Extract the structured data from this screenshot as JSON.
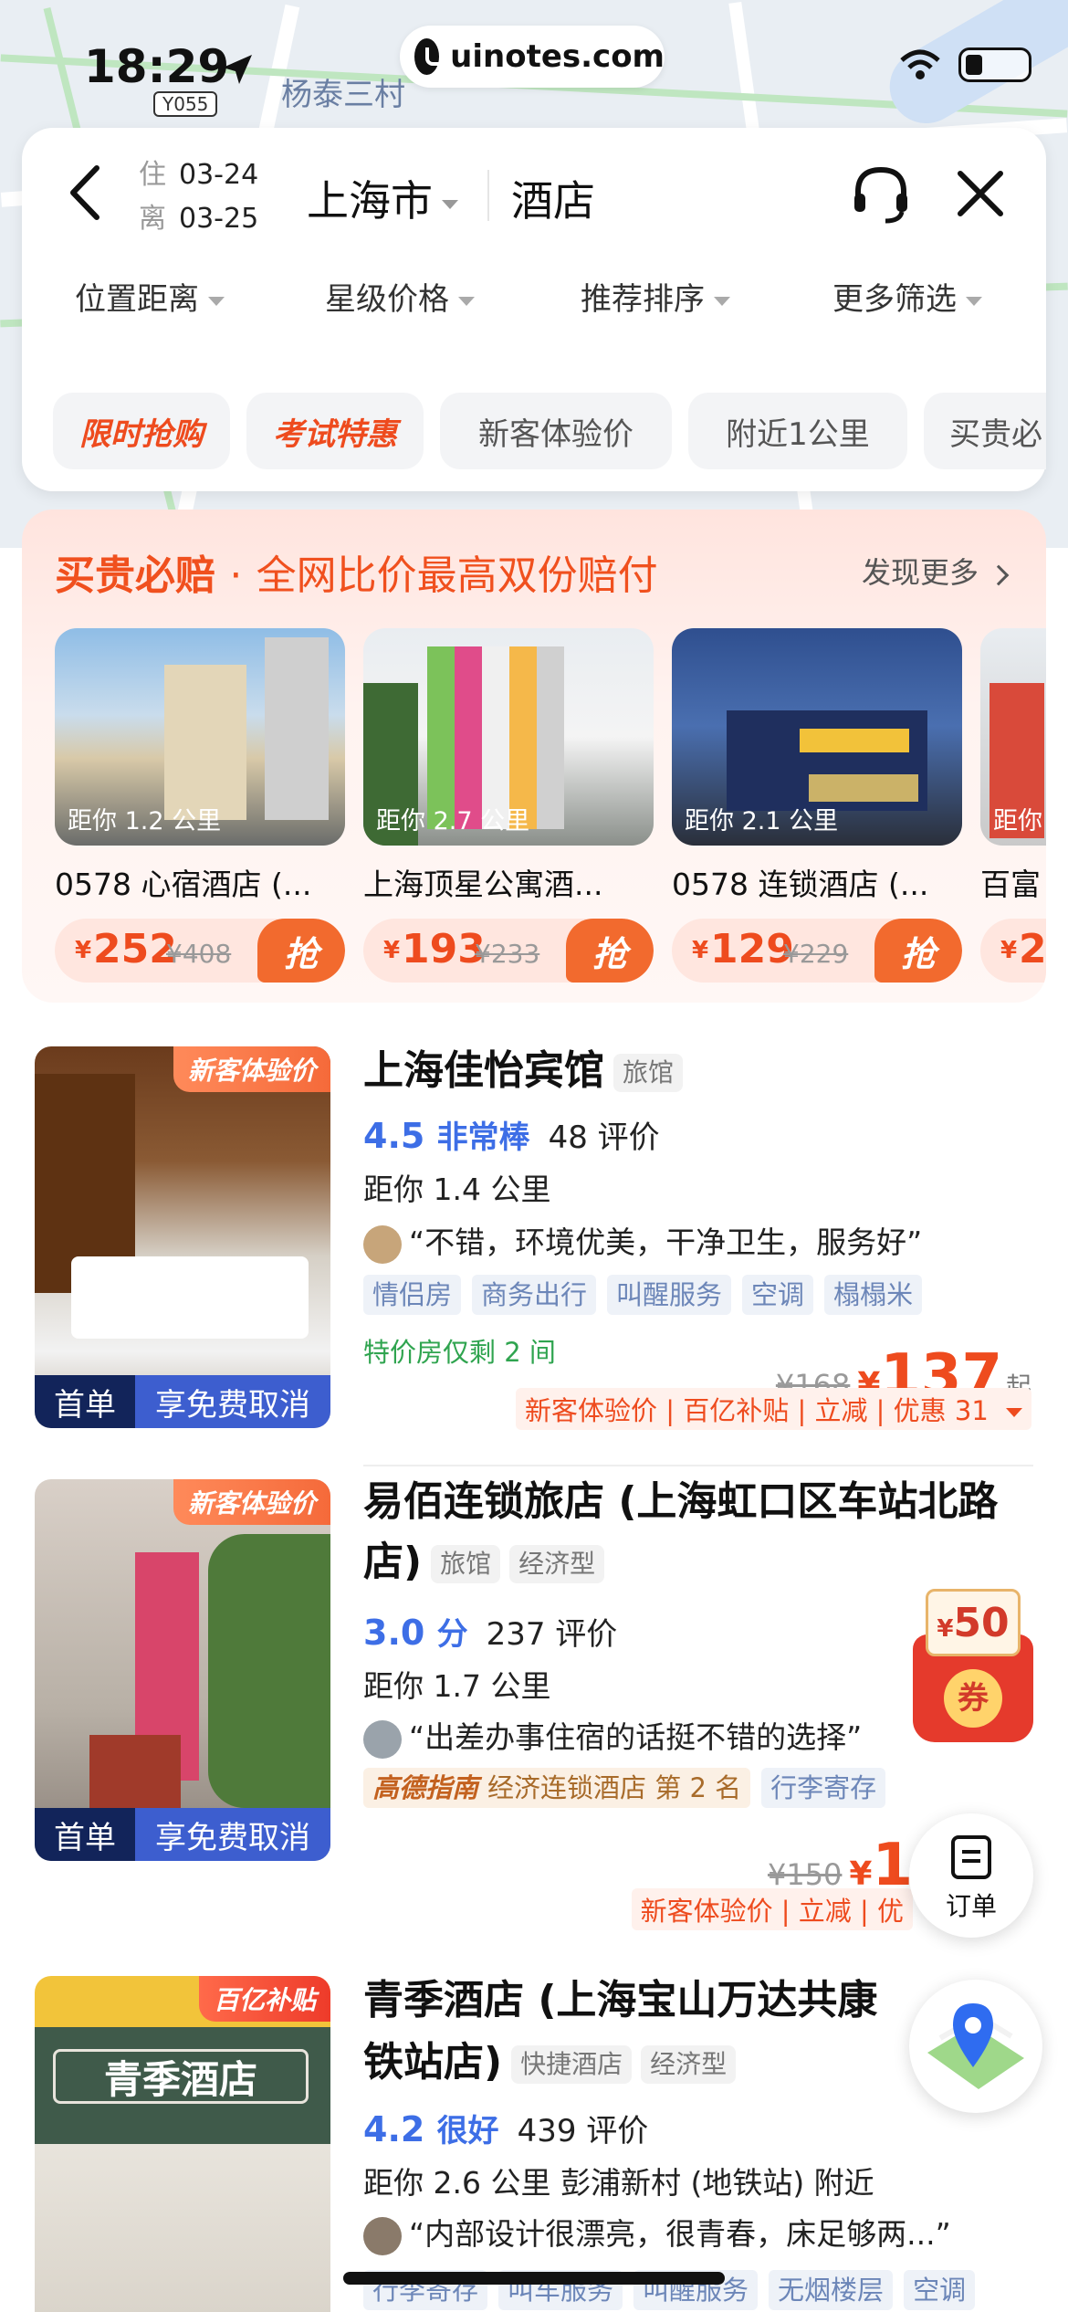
{
  "status_bar": {
    "time": "18:29",
    "sub_badge": "Y055",
    "url": "uinotes.com"
  },
  "map": {
    "label": "杨泰三村"
  },
  "header": {
    "checkin_label": "住",
    "checkin_date": "03-24",
    "checkout_label": "离",
    "checkout_date": "03-25",
    "city": "上海市",
    "keyword": "酒店"
  },
  "filters": [
    {
      "label": "位置距离"
    },
    {
      "label": "星级价格"
    },
    {
      "label": "推荐排序"
    },
    {
      "label": "更多筛选"
    }
  ],
  "chips": [
    {
      "label": "限时抢购",
      "hot": true
    },
    {
      "label": "考试特惠",
      "hot": true
    },
    {
      "label": "新客体验价",
      "hot": false
    },
    {
      "label": "附近1公里",
      "hot": false
    },
    {
      "label": "买贵必",
      "hot": false
    }
  ],
  "promo": {
    "title_main": "买贵必赔",
    "title_sep": "·",
    "title_rest": "全网比价最高双份赔付",
    "more": "发现更多",
    "cards": [
      {
        "distance": "距你 1.2 公里",
        "name": "0578 心宿酒店 (...",
        "currency": "¥",
        "price": "252",
        "old_price": "¥408",
        "grab": "抢"
      },
      {
        "distance": "距你 2.7 公里",
        "name": "上海顶星公寓酒...",
        "currency": "¥",
        "price": "193",
        "old_price": "¥233",
        "grab": "抢"
      },
      {
        "distance": "距你 2.1 公里",
        "name": "0578 连锁酒店 (...",
        "currency": "¥",
        "price": "129",
        "old_price": "¥229",
        "grab": "抢"
      },
      {
        "distance": "距你",
        "name": "百富",
        "currency": "¥",
        "price": "2",
        "old_price": "",
        "grab": ""
      }
    ]
  },
  "hotels": [
    {
      "tag": "新客体验价",
      "first_order": "首单",
      "free_cancel": "享免费取消",
      "name": "上海佳怡宾馆",
      "badges": [
        "旅馆"
      ],
      "score": "4.5",
      "level": "非常棒",
      "reviews": "48 评价",
      "distance": "距你 1.4 公里",
      "quote": "“不错，环境优美，干净卫生，服务好”",
      "tags": [
        "情侣房",
        "商务出行",
        "叫醒服务",
        "空调",
        "榻榻米"
      ],
      "left_rooms": "特价房仅剩 2 间",
      "old_price": "¥168",
      "currency": "¥",
      "price": "137",
      "price_suffix": "起",
      "deals": "新客体验价 | 百亿补贴 | 立减 | 优惠 31"
    },
    {
      "tag": "新客体验价",
      "first_order": "首单",
      "free_cancel": "享免费取消",
      "name": "易佰连锁旅店 (上海虹口区车站北路店)",
      "badges": [
        "旅馆",
        "经济型"
      ],
      "score": "3.0",
      "level": "分",
      "reviews": "237 评价",
      "distance": "距你 1.7 公里",
      "quote": "“出差办事住宿的话挺不错的选择”",
      "rank_brand": "高德指南",
      "rank_text": "经济连锁酒店 第 2 名",
      "tags": [
        "行李寄存"
      ],
      "old_price": "¥150",
      "currency": "¥",
      "price": "1",
      "deals": "新客体验价 | 立减 | 优"
    },
    {
      "tag": "百亿补贴",
      "name": "青季酒店 (上海宝山万达共康路地铁站店)",
      "name_visible": "青季酒店 (上海宝山万达共康",
      "name_line2": "铁站店)",
      "badges": [
        "快捷酒店",
        "经济型"
      ],
      "score": "4.2",
      "level": "很好",
      "reviews": "439 评价",
      "distance": "距你 2.6 公里  彭浦新村 (地铁站) 附近",
      "quote": "“内部设计很漂亮，很青春，床足够两...”",
      "tags": [
        "行李寄存",
        "叫车服务",
        "叫醒服务",
        "无烟楼层",
        "空调"
      ],
      "sign": "青季酒店"
    }
  ],
  "floating": {
    "coupon_amount": "50",
    "coupon_currency": "¥",
    "coupon_seal": "券",
    "order_label": "订单"
  }
}
